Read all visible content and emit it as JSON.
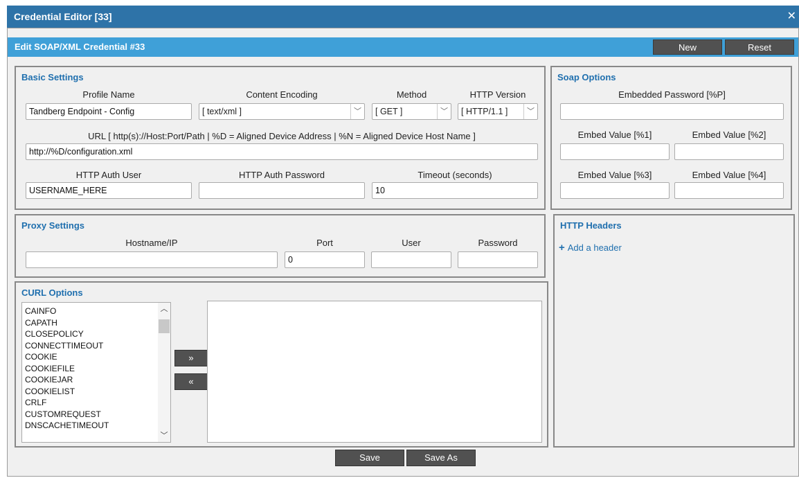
{
  "window": {
    "title": "Credential Editor [33]"
  },
  "editor": {
    "heading": "Edit SOAP/XML Credential #33",
    "new_label": "New",
    "reset_label": "Reset"
  },
  "basic": {
    "title": "Basic Settings",
    "profile_name_label": "Profile Name",
    "profile_name_value": "Tandberg Endpoint - Config",
    "content_encoding_label": "Content Encoding",
    "content_encoding_value": "[ text/xml ]",
    "method_label": "Method",
    "method_value": "[ GET ]",
    "http_version_label": "HTTP Version",
    "http_version_value": "[ HTTP/1.1 ]",
    "url_label": "URL [ http(s)://Host:Port/Path | %D = Aligned Device Address | %N = Aligned Device Host Name ]",
    "url_value": "http://%D/configuration.xml",
    "auth_user_label": "HTTP Auth User",
    "auth_user_value": "USERNAME_HERE",
    "auth_password_label": "HTTP Auth Password",
    "auth_password_value": "",
    "timeout_label": "Timeout (seconds)",
    "timeout_value": "10"
  },
  "soap": {
    "title": "Soap Options",
    "embedded_password_label": "Embedded Password [%P]",
    "embed1_label": "Embed Value [%1]",
    "embed2_label": "Embed Value [%2]",
    "embed3_label": "Embed Value [%3]",
    "embed4_label": "Embed Value [%4]"
  },
  "proxy": {
    "title": "Proxy Settings",
    "hostname_label": "Hostname/IP",
    "hostname_value": "",
    "port_label": "Port",
    "port_value": "0",
    "user_label": "User",
    "user_value": "",
    "password_label": "Password",
    "password_value": ""
  },
  "headers": {
    "title": "HTTP Headers",
    "add_label": "Add a header"
  },
  "curl": {
    "title": "CURL Options",
    "options": [
      "CAINFO",
      "CAPATH",
      "CLOSEPOLICY",
      "CONNECTTIMEOUT",
      "COOKIE",
      "COOKIEFILE",
      "COOKIEJAR",
      "COOKIELIST",
      "CRLF",
      "CUSTOMREQUEST",
      "DNSCACHETIMEOUT"
    ],
    "add_arrow": "»",
    "remove_arrow": "«"
  },
  "footer": {
    "save_label": "Save",
    "save_as_label": "Save As"
  },
  "colors": {
    "title_bar": "#2e73a8",
    "sub_bar": "#3fa0d8",
    "button": "#515151",
    "panel_title": "#1f6fae"
  }
}
